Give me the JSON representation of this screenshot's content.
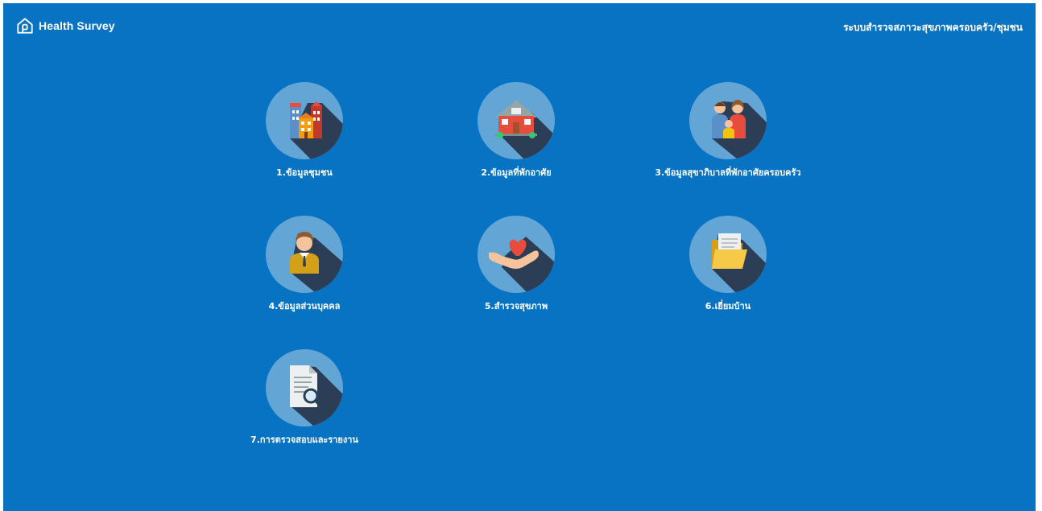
{
  "header": {
    "brand_name": "Health Survey",
    "brand_icon": "home-icon",
    "system_title": "ระบบสำรวจสภาวะสุขภาพครอบครัว/ชุมชน"
  },
  "colors": {
    "background": "#0873c3",
    "circle": "#63a6d6",
    "shadow": "#2c3e56",
    "text": "#ffffff"
  },
  "menu": [
    {
      "label": "1.ข้อมูลชุมชน",
      "icon": "community-buildings-icon"
    },
    {
      "label": "2.ข้อมูลที่พักอาศัย",
      "icon": "house-icon"
    },
    {
      "label": "3.ข้อมูลสุขาภิบาลที่พักอาศัยครอบครัว",
      "icon": "family-icon"
    },
    {
      "label": "4.ข้อมูลส่วนบุคคล",
      "icon": "person-icon"
    },
    {
      "label": "5.สำรวจสุขภาพ",
      "icon": "heart-in-hand-icon"
    },
    {
      "label": "6.เยี่ยมบ้าน",
      "icon": "folder-icon"
    },
    {
      "label": "7.การตรวจสอบและรายงาน",
      "icon": "document-search-icon"
    }
  ]
}
